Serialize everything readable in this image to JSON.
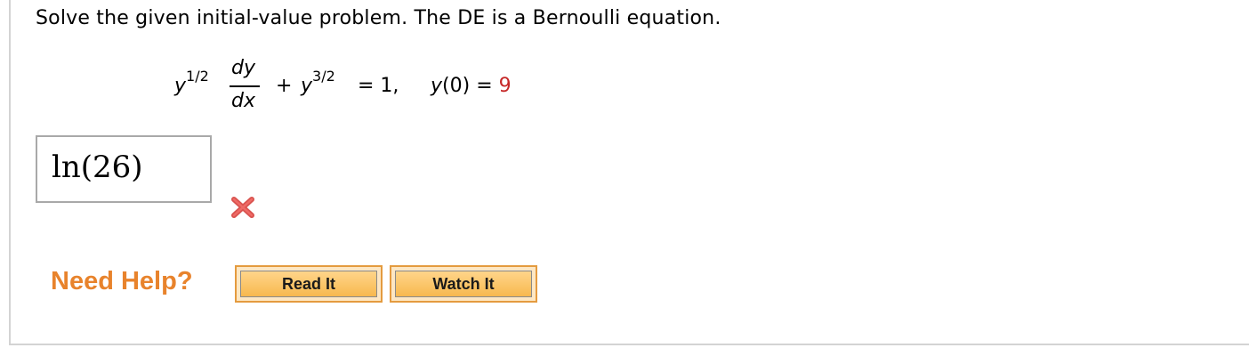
{
  "problem": {
    "prompt": "Solve the given initial-value problem. The DE is a Bernoulli equation.",
    "equation": {
      "term1_base": "y",
      "term1_exp": "1/2",
      "frac_num": "dy",
      "frac_den": "dx",
      "plus": "+",
      "term2_base": "y",
      "term2_exp": "3/2",
      "rhs": "= 1,",
      "ic_lhs": "y",
      "ic_arg": "(0)",
      "ic_eq": "=",
      "ic_value": "9"
    }
  },
  "answer": {
    "value": "ln(26)",
    "status_icon": "wrong-x-icon",
    "status_color": "#d9534f"
  },
  "help": {
    "label": "Need Help?",
    "read_label": "Read It",
    "watch_label": "Watch It",
    "accent": "#e8832c"
  }
}
